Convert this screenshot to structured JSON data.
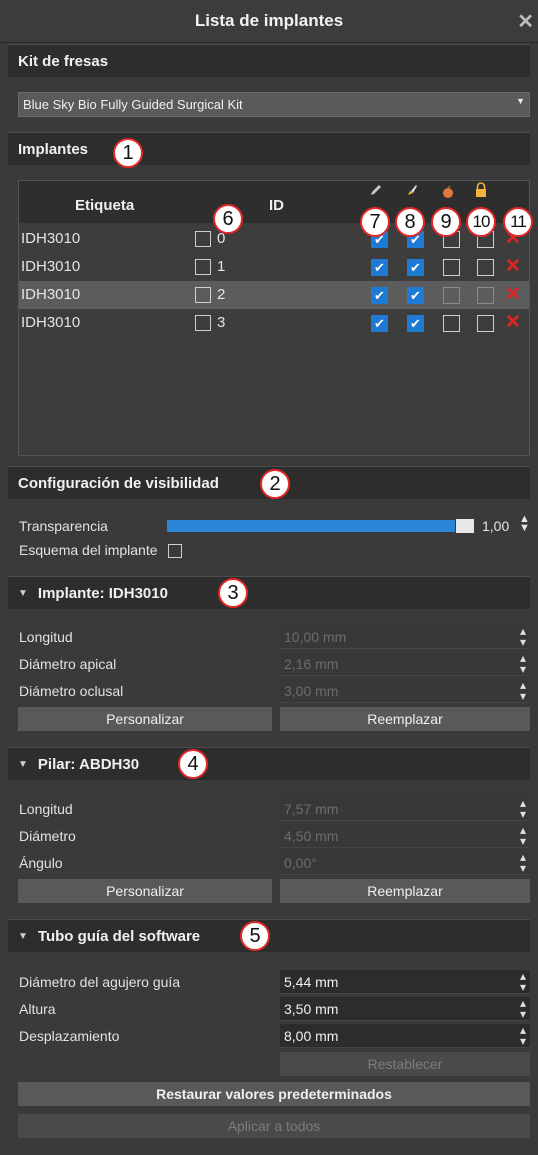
{
  "window": {
    "title": "Lista de implantes",
    "close_glyph": "✕"
  },
  "drill_kit": {
    "header": "Kit de fresas",
    "selected": "Blue Sky Bio Fully Guided Surgical Kit"
  },
  "implants": {
    "header": "Implantes",
    "columns": {
      "label": "Etiqueta",
      "id": "ID"
    },
    "column_icons": [
      "pencil-icon",
      "brush-icon",
      "apple-icon",
      "lock-icon"
    ],
    "rows": [
      {
        "label": "IDH3010",
        "id": "0",
        "visible": true,
        "brush": true,
        "col9": false,
        "lock": false,
        "selected": false
      },
      {
        "label": "IDH3010",
        "id": "1",
        "visible": true,
        "brush": true,
        "col9": false,
        "lock": false,
        "selected": false
      },
      {
        "label": "IDH3010",
        "id": "2",
        "visible": true,
        "brush": true,
        "col9": false,
        "lock": false,
        "selected": true
      },
      {
        "label": "IDH3010",
        "id": "3",
        "visible": true,
        "brush": true,
        "col9": false,
        "lock": false,
        "selected": false
      }
    ]
  },
  "visibility": {
    "header": "Configuración de visibilidad",
    "transparency_label": "Transparencia",
    "transparency_value": "1,00",
    "transparency_fraction": 1.0,
    "outline_label": "Esquema del implante",
    "outline_checked": false
  },
  "implant_detail": {
    "header": "Implante: IDH3010",
    "length_label": "Longitud",
    "length_value": "10,00 mm",
    "apical_label": "Diámetro apical",
    "apical_value": "2,16 mm",
    "occlusal_label": "Diámetro oclusal",
    "occlusal_value": "3,00 mm",
    "customize": "Personalizar",
    "replace": "Reemplazar"
  },
  "abutment": {
    "header": "Pilar: ABDH30",
    "length_label": "Longitud",
    "length_value": "7,57 mm",
    "diameter_label": "Diámetro",
    "diameter_value": "4,50 mm",
    "angle_label": "Ángulo",
    "angle_value": "0,00°",
    "customize": "Personalizar",
    "replace": "Reemplazar"
  },
  "sleeve": {
    "header": "Tubo guía del software",
    "hole_label": "Diámetro del agujero guía",
    "hole_value": "5,44 mm",
    "height_label": "Altura",
    "height_value": "3,50 mm",
    "offset_label": "Desplazamiento",
    "offset_value": "8,00 mm",
    "reset": "Restablecer",
    "restore_defaults": "Restaurar valores predeterminados",
    "apply_all": "Aplicar a todos"
  },
  "callouts": [
    "1",
    "2",
    "3",
    "4",
    "5",
    "6",
    "7",
    "8",
    "9",
    "10",
    "11"
  ],
  "colors": {
    "accent": "#1e7ad2",
    "delete": "#e52525",
    "callout_ring": "#e22828"
  }
}
